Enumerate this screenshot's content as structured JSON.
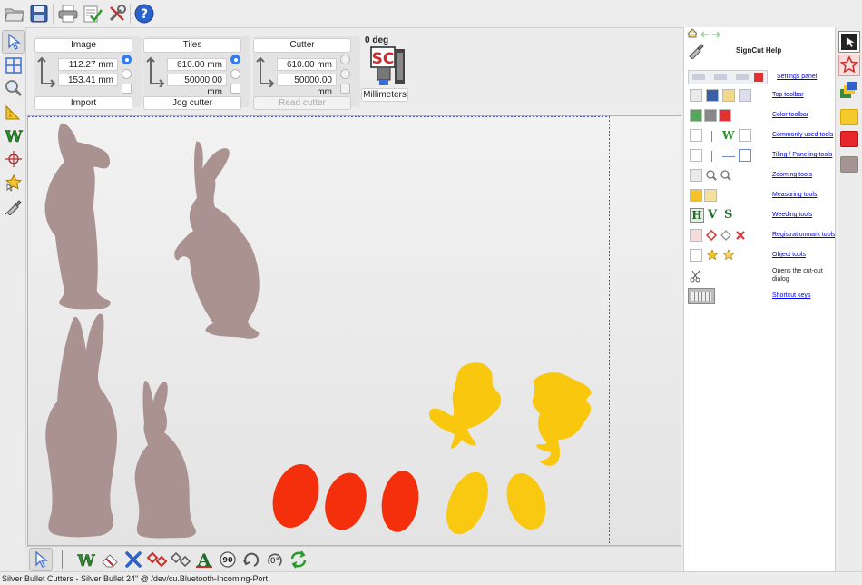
{
  "settings": {
    "image": {
      "title": "Image",
      "x_value": "112.27 mm",
      "y_value": "153.41 mm",
      "button": "Import"
    },
    "tiles": {
      "title": "Tiles",
      "x_value": "610.00 mm",
      "y_value": "50000.00 mm",
      "button": "Jog cutter"
    },
    "cutter": {
      "title": "Cutter",
      "x_value": "610.00 mm",
      "y_value": "50000.00 mm",
      "button": "Read cutter"
    },
    "rotation_label": "0 deg",
    "logo_text": "SC",
    "units_button": "Millimeters"
  },
  "help": {
    "title": "SignCut Help",
    "items": [
      {
        "label": "Settings panel"
      },
      {
        "label": "Top toolbar"
      },
      {
        "label": "Color toolbar"
      },
      {
        "label": "Commonly used tools"
      },
      {
        "label": "Tiling / Paneling tools"
      },
      {
        "label": "Zooming tools"
      },
      {
        "label": "Measuring tools"
      },
      {
        "label": "Weeding tools"
      },
      {
        "label": "Registrationmark tools"
      },
      {
        "label": "Object tools"
      },
      {
        "label": "Opens the cut-out dialog"
      },
      {
        "label": "Shortcut keys"
      }
    ],
    "weed_letters": {
      "h": "H",
      "v": "V",
      "s": "S"
    }
  },
  "bottom_toolbar": {
    "rot90": "90",
    "rot0": "0°"
  },
  "status": "Silver Bullet Cutters - Silver Bullet 24\" @ /dev/cu.Bluetooth-Incoming-Port",
  "colors": {
    "bunny": "#a99290",
    "chick": "#f8c70e",
    "egg_red": "#f4300c",
    "egg_yellow": "#f9c810",
    "accent": "#2f7cf6"
  }
}
